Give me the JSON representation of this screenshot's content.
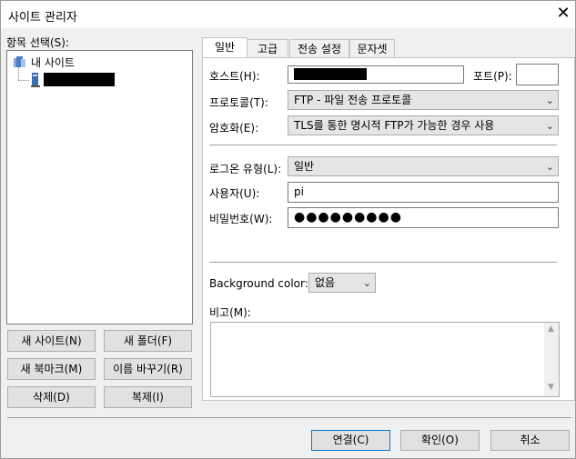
{
  "window": {
    "title": "사이트 관리자",
    "close_label": "✕"
  },
  "left": {
    "entries_label": "항목 선택(S):",
    "tree": {
      "root_label": "내 사이트",
      "child_label": ""
    },
    "buttons": {
      "new_site": "새 사이트(N)",
      "new_folder": "새 폴더(F)",
      "new_bookmark": "새 북마크(M)",
      "rename": "이름 바꾸기(R)",
      "delete": "삭제(D)",
      "duplicate": "복제(I)"
    }
  },
  "tabs": [
    "일반",
    "고급",
    "전송 설정",
    "문자셋"
  ],
  "general": {
    "host_label": "호스트(H):",
    "host_value": "",
    "port_label": "포트(P):",
    "port_value": "",
    "protocol_label": "프로토콜(T):",
    "protocol_value": "FTP - 파일 전송 프로토콜",
    "encryption_label": "암호화(E):",
    "encryption_value": "TLS를 통한 명시적 FTP가 가능한 경우 사용",
    "logon_label": "로그온 유형(L):",
    "logon_value": "일반",
    "user_label": "사용자(U):",
    "user_value": "pi",
    "password_label": "비밀번호(W):",
    "password_value": "●●●●●●●●●",
    "bgcolor_label": "Background color:",
    "bgcolor_value": "없음",
    "comments_label": "비고(M):"
  },
  "footer": {
    "connect": "연결(C)",
    "ok": "확인(O)",
    "cancel": "취소"
  },
  "colors": {
    "accent": "#0078d7",
    "redacted": "#000000"
  },
  "icons": [
    "close-icon",
    "folder-icon",
    "server-icon",
    "chevron-down-icon"
  ]
}
